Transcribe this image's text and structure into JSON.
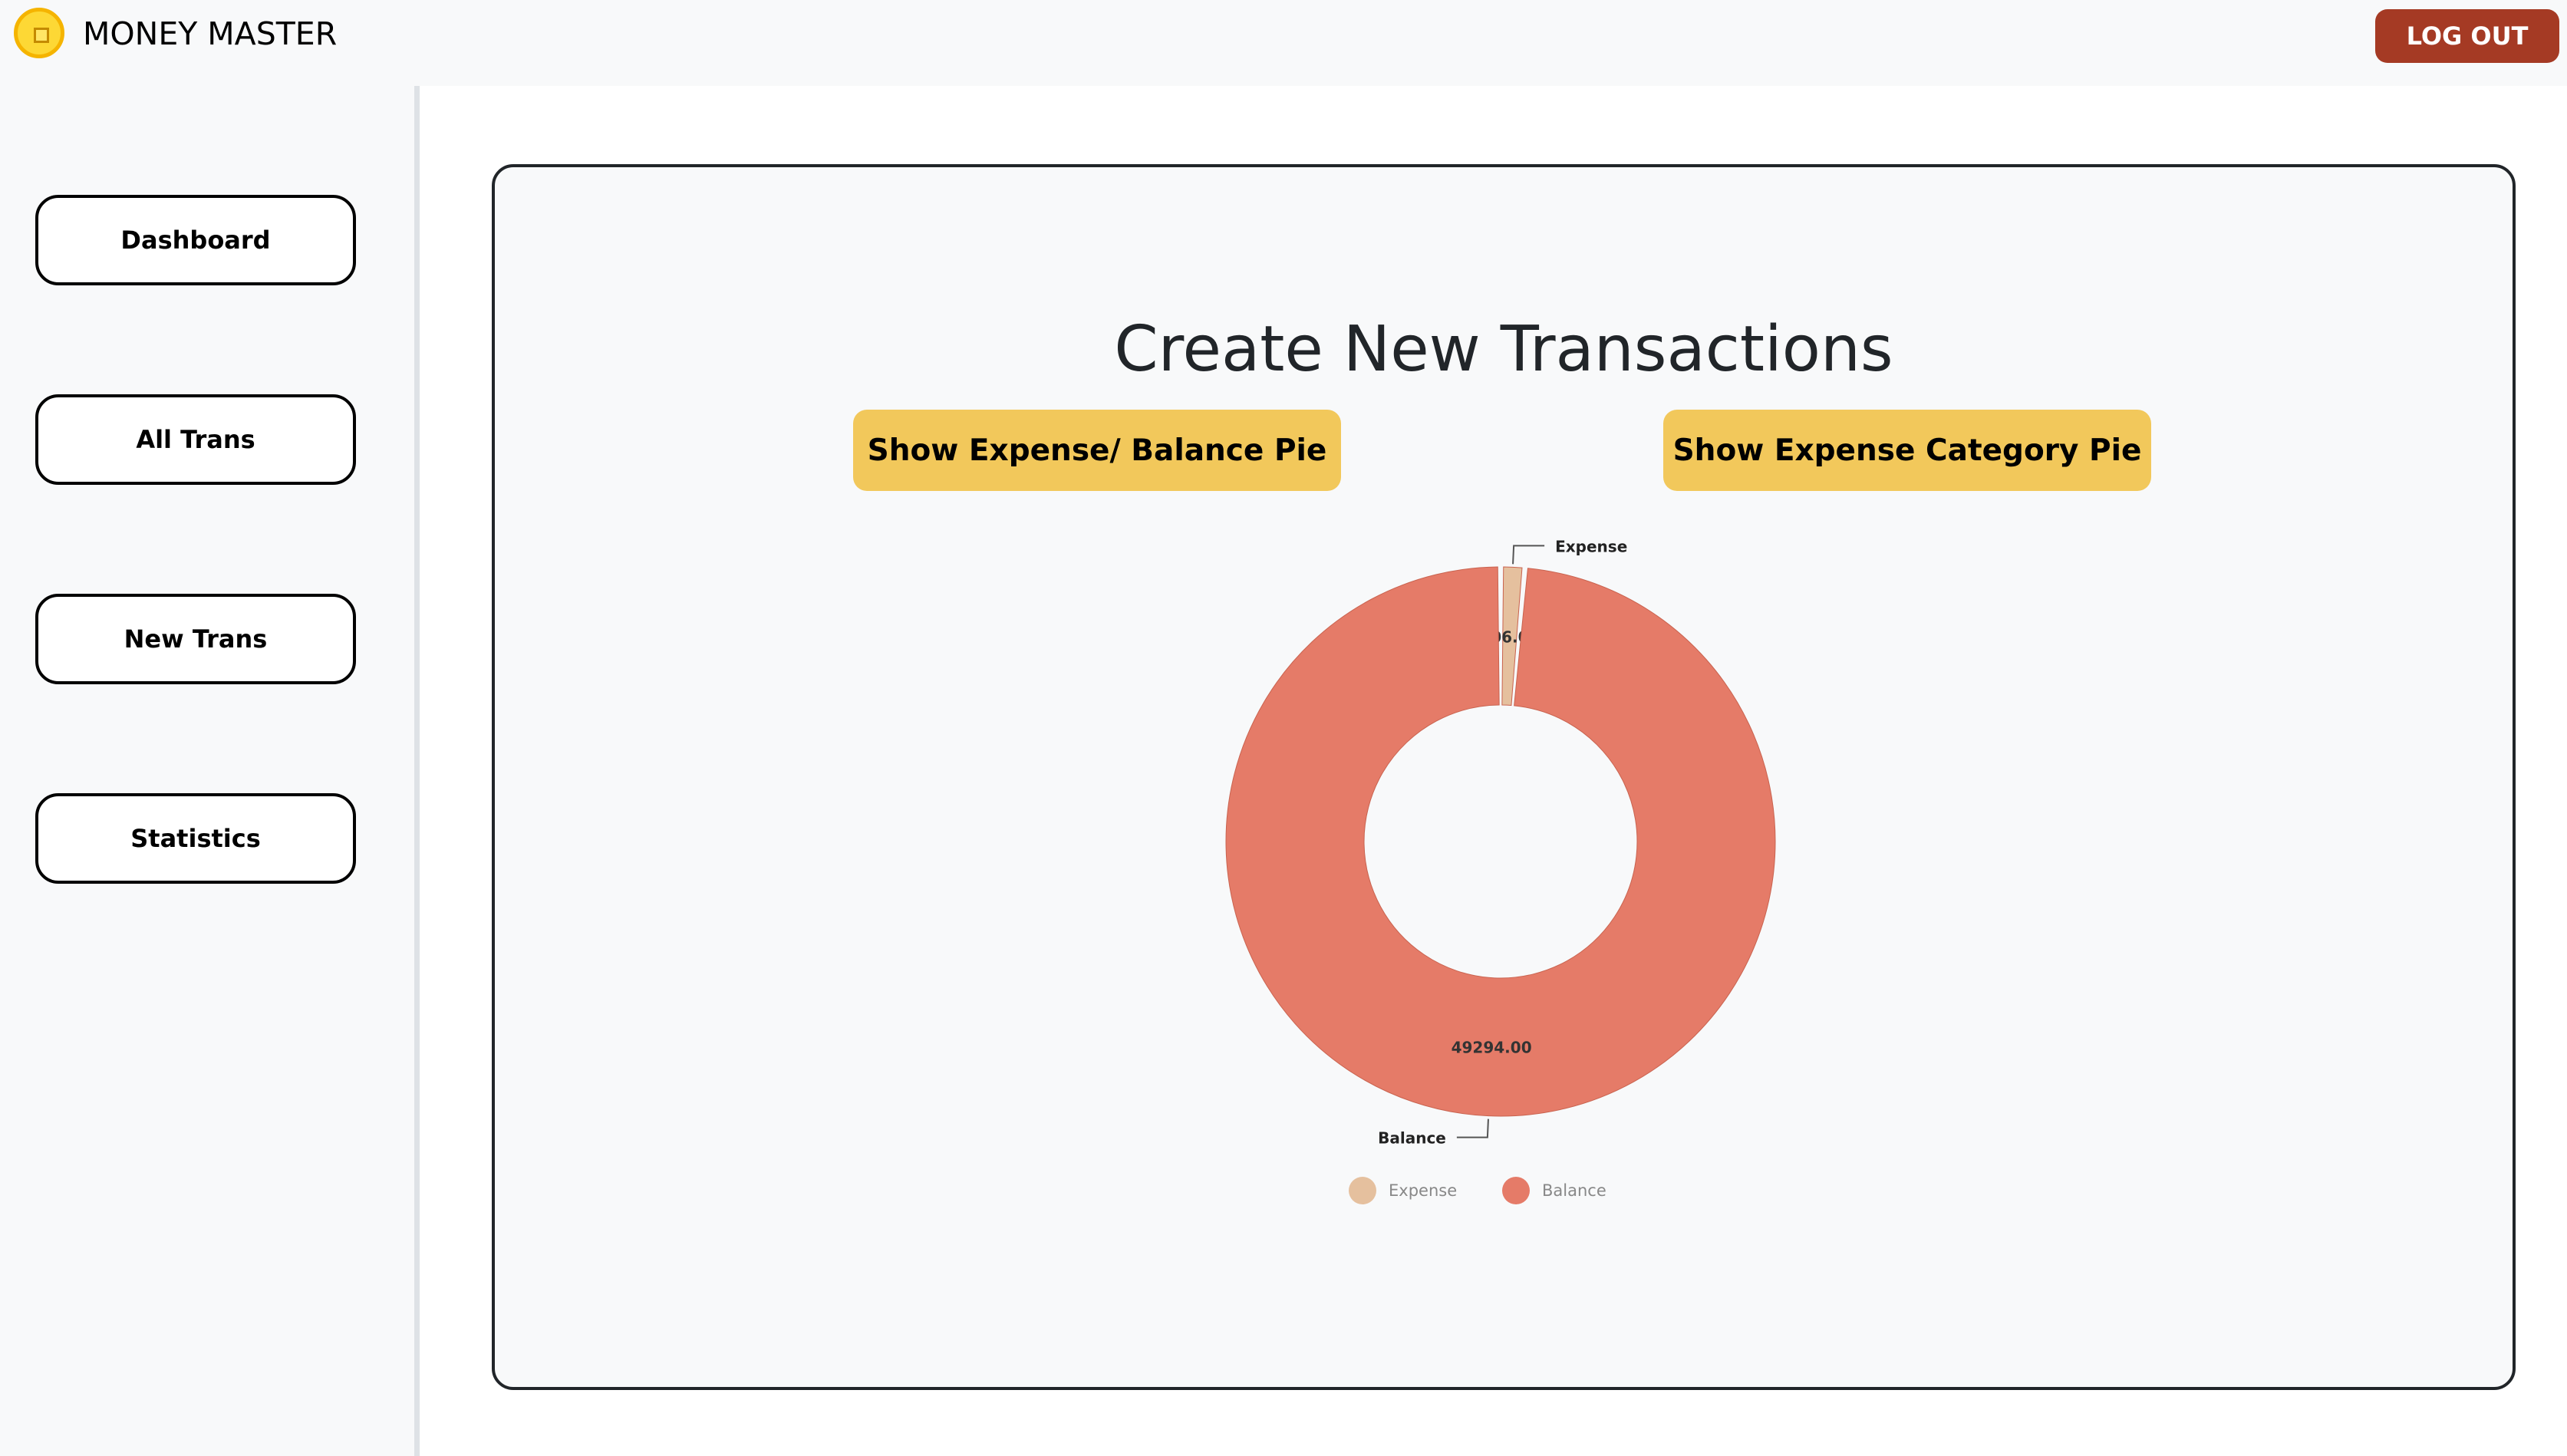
{
  "app": {
    "brand": "MONEY MASTER",
    "logout_label": "LOG OUT"
  },
  "sidebar": {
    "items": [
      {
        "label": "Dashboard"
      },
      {
        "label": "All Trans"
      },
      {
        "label": "New Trans"
      },
      {
        "label": "Statistics"
      }
    ]
  },
  "main": {
    "title": "Create New Transactions",
    "buttons": {
      "expense_balance": "Show Expense/ Balance Pie",
      "expense_category": "Show Expense Category Pie"
    }
  },
  "colors": {
    "logout": "#a53a24",
    "button_yellow": "#f2c85b",
    "expense": "#e5c09e",
    "balance": "#e57b68"
  },
  "chart_data": {
    "type": "pie",
    "variant": "donut",
    "categories": [
      "Expense",
      "Balance"
    ],
    "values": [
      706.0,
      49294.0
    ],
    "value_labels": [
      "706.00",
      "49294.00"
    ],
    "colors": [
      "#e5c09e",
      "#e57b68"
    ],
    "legend": {
      "entries": [
        "Expense",
        "Balance"
      ],
      "position": "bottom"
    }
  }
}
